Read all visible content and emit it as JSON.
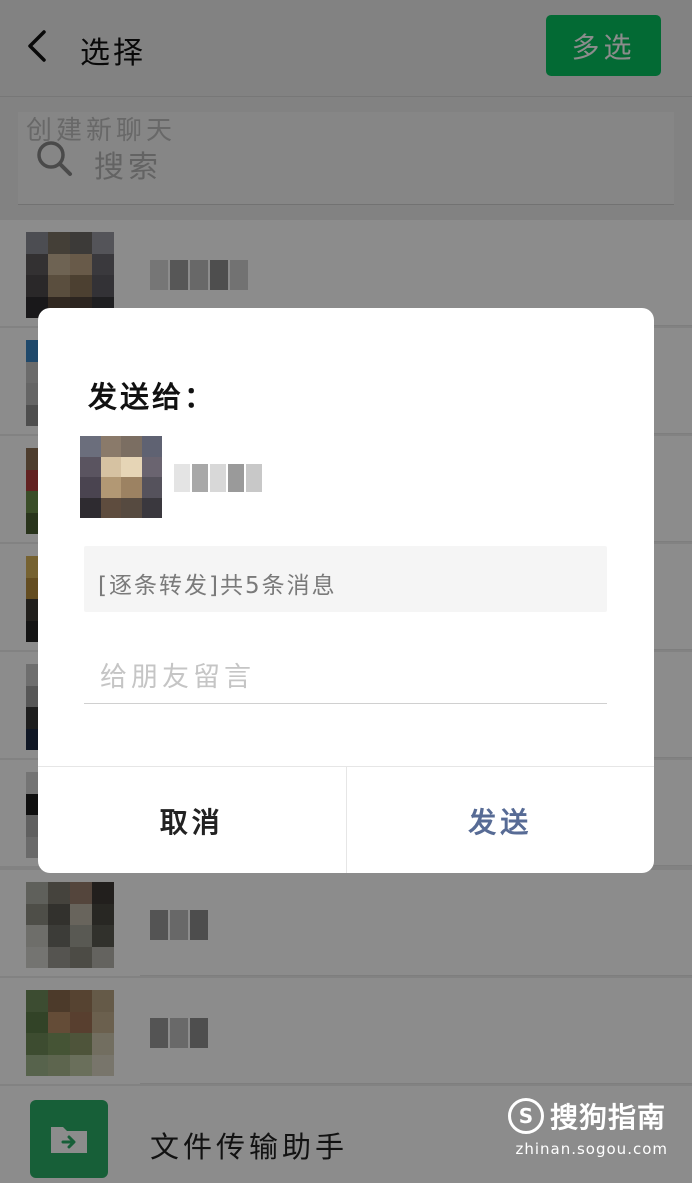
{
  "header": {
    "title": "选择",
    "multi_select_label": "多选"
  },
  "background_text": "创建新聊天",
  "search": {
    "placeholder": "搜索"
  },
  "file_transfer": {
    "label": "文件传输助手"
  },
  "dialog": {
    "title": "发送给：",
    "message_preview": "[逐条转发]共5条消息",
    "note_placeholder": "给朋友留言",
    "cancel_label": "取消",
    "send_label": "发送"
  },
  "watermark": {
    "brand": "搜狗指南",
    "url": "zhinan.sogou.com"
  },
  "colors": {
    "accent_green": "#07c160",
    "link_blue": "#576b95"
  }
}
